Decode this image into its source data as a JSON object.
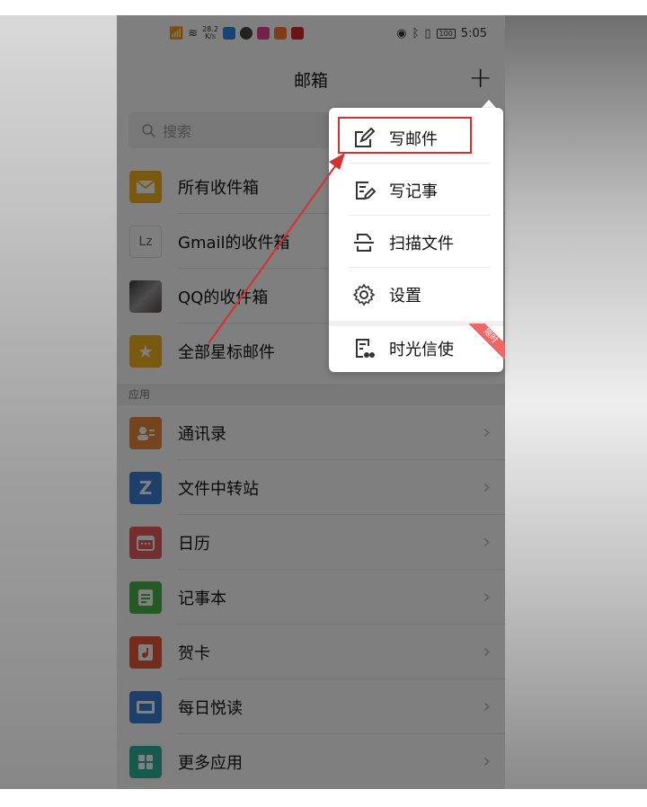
{
  "status_bar": {
    "network_speed_value": "28.2",
    "network_speed_unit": "K/s",
    "battery": "100",
    "time": "5:05"
  },
  "header": {
    "title": "邮箱",
    "add_glyph": "+"
  },
  "search": {
    "placeholder": "搜索"
  },
  "mailboxes": [
    {
      "label": "所有收件箱",
      "icon": "envelope-icon",
      "color": "#f2b01e"
    },
    {
      "label": "Gmail的收件箱",
      "icon": "lz-avatar",
      "icon_text": "Lz",
      "color": "#ffffff"
    },
    {
      "label": "QQ的收件箱",
      "icon": "photo-avatar",
      "color": "#5a5a5a"
    },
    {
      "label": "全部星标邮件",
      "icon": "star-icon",
      "color": "#f2b01e"
    }
  ],
  "apps_section": {
    "header": "应用",
    "items": [
      {
        "label": "通讯录",
        "icon": "contacts-icon",
        "color": "#e8883a"
      },
      {
        "label": "文件中转站",
        "icon": "transfer-icon",
        "color": "#3e7fd6"
      },
      {
        "label": "日历",
        "icon": "calendar-icon",
        "color": "#e85c5c"
      },
      {
        "label": "记事本",
        "icon": "notes-icon",
        "color": "#4bb54b"
      },
      {
        "label": "贺卡",
        "icon": "greeting-card-icon",
        "color": "#e8583a"
      },
      {
        "label": "每日悦读",
        "icon": "reading-icon",
        "color": "#3e7fd6"
      },
      {
        "label": "更多应用",
        "icon": "more-apps-icon",
        "color": "#2bb59a"
      }
    ]
  },
  "popup_menu": {
    "items": [
      {
        "label": "写邮件",
        "icon": "compose-icon"
      },
      {
        "label": "写记事",
        "icon": "write-note-icon"
      },
      {
        "label": "扫描文件",
        "icon": "scan-icon"
      },
      {
        "label": "设置",
        "icon": "gear-icon"
      },
      {
        "label": "时光信使",
        "icon": "time-messenger-icon"
      }
    ],
    "badge": "限时"
  },
  "colors": {
    "annotation_red": "#d63030",
    "overlay": "rgba(0,0,0,0.5)"
  }
}
